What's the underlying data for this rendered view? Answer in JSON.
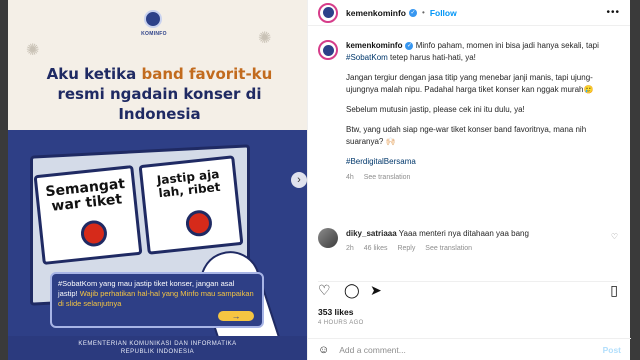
{
  "image": {
    "logo_text": "KOMINFO",
    "headline_part1": "Aku ketika ",
    "headline_hl": "band favorit-ku",
    "headline_part2": " resmi ngadain konser di Indonesia",
    "card1": "Semangat war tiket",
    "card2": "Jastip aja lah, ribet",
    "callout_part1": "#SobatKom yang mau jastip tiket konser, jangan asal jastip! ",
    "callout_part2": "Wajib perhatikan hal-hal yang Minfo mau sampaikan di slide selanjutnya",
    "arrow": "→",
    "footer_line1": "KEMENTERIAN KOMUNIKASI DAN INFORMATIKA",
    "footer_line2": "REPUBLIK INDONESIA",
    "next_icon": "chevron-right"
  },
  "header": {
    "username": "kemenkominfo",
    "verified": "✓",
    "separator": "•",
    "follow": "Follow",
    "more": "•••"
  },
  "caption": {
    "username": "kemenkominfo",
    "p1_a": " Minfo paham, momen ini bisa jadi hanya sekali, tapi ",
    "p1_tag": "#SobatKom",
    "p1_b": " tetep harus hati-hati, ya!",
    "p2": "Jangan tergiur dengan jasa titip yang menebar janji manis, tapi ujung-ujungnya malah nipu. Padahal harga tiket konser kan nggak murah🥲",
    "p3": "Sebelum mutusin jastip, please cek ini itu dulu, ya!",
    "p4": "Btw, yang udah siap nge-war tiket konser band favoritnya, mana nih suaranya? 🙌🏻",
    "hashtag": "#BerdigitalBersama",
    "time": "4h",
    "see_translation": "See translation"
  },
  "comment": {
    "username": "diky_satriaaa",
    "text": " Yaaa menteri nya ditahaan yaa bang",
    "time": "2h",
    "likes": "46 likes",
    "reply": "Reply",
    "see_translation": "See translation"
  },
  "actions": {
    "likes": "353 likes",
    "ago": "4 HOURS AGO"
  },
  "add_comment": {
    "placeholder": "Add a comment...",
    "post": "Post"
  },
  "colors": {
    "accent": "#0095f6",
    "brand_navy": "#2e3f86",
    "highlight": "#c26b1e",
    "button_red": "#d62a1a"
  }
}
